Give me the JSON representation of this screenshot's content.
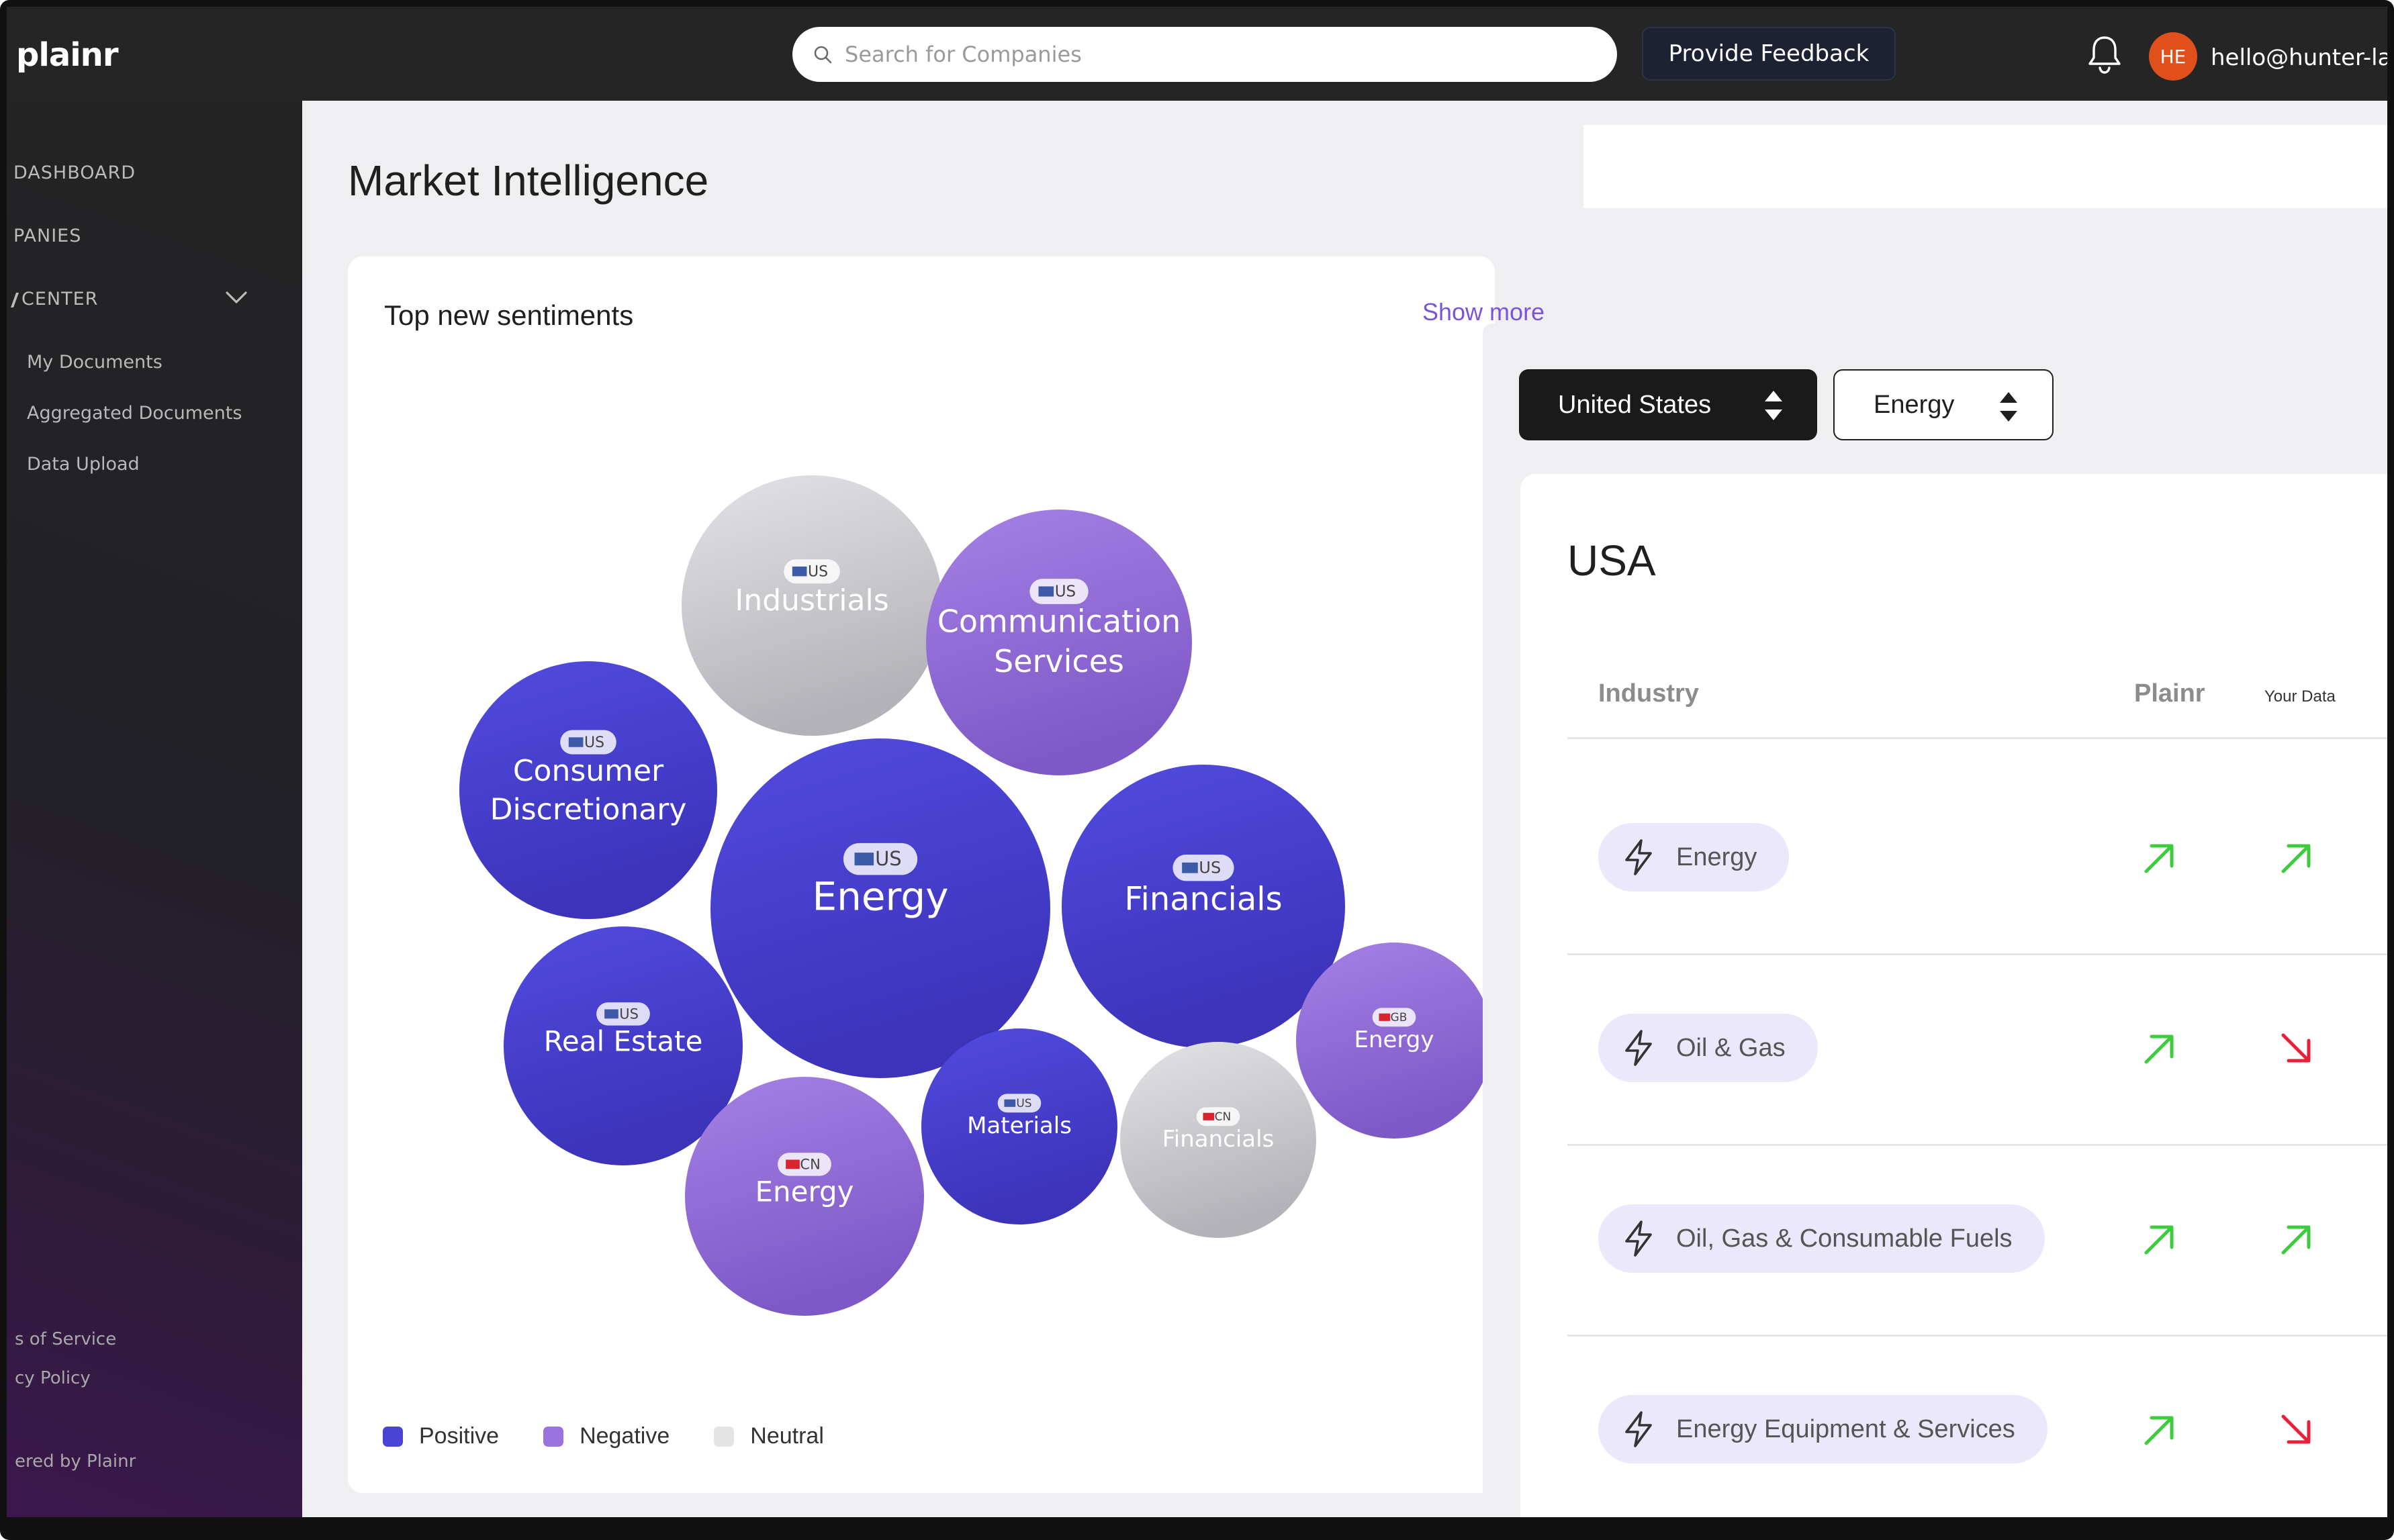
{
  "app": {
    "logo": "plainr"
  },
  "topbar": {
    "search_placeholder": "Search for Companies",
    "feedback_label": "Provide Feedback",
    "avatar_initials": "HE",
    "email": "hello@hunter-la"
  },
  "sidebar": {
    "items": [
      {
        "label": "DASHBOARD"
      },
      {
        "label": "PANIES"
      },
      {
        "label": "CENTER"
      }
    ],
    "sub_items": [
      {
        "label": "My Documents"
      },
      {
        "label": "Aggregated Documents"
      },
      {
        "label": "Data Upload"
      }
    ],
    "footer": {
      "terms": "s of Service",
      "privacy": "cy Policy",
      "powered": "ered by Plainr"
    }
  },
  "main": {
    "title": "Market Intelligence",
    "card_title": "Top new sentiments",
    "show_more": "Show more"
  },
  "colors": {
    "positive": "#4a44d6",
    "negative": "#9b73df",
    "neutral": "#e4e4e4",
    "accent": "#7b55d8",
    "up": "#3dcc3d",
    "down": "#e8213a"
  },
  "chart_data": {
    "type": "bubble",
    "bubbles": [
      {
        "name": "Industrials",
        "country": "US",
        "sentiment": "neutral"
      },
      {
        "name": "Communication Services",
        "country": "US",
        "sentiment": "negative"
      },
      {
        "name": "Consumer Discretionary",
        "country": "US",
        "sentiment": "positive"
      },
      {
        "name": "Energy",
        "country": "US",
        "sentiment": "positive"
      },
      {
        "name": "Financials",
        "country": "US",
        "sentiment": "positive"
      },
      {
        "name": "Real Estate",
        "country": "US",
        "sentiment": "positive"
      },
      {
        "name": "Energy",
        "country": "GB",
        "sentiment": "negative"
      },
      {
        "name": "Energy",
        "country": "CN",
        "sentiment": "negative"
      },
      {
        "name": "Materials",
        "country": "US",
        "sentiment": "positive"
      },
      {
        "name": "Financials",
        "country": "CN",
        "sentiment": "neutral"
      }
    ],
    "legend": [
      "Positive",
      "Negative",
      "Neutral"
    ]
  },
  "panel": {
    "country_select": "United States",
    "sector_select": "Energy",
    "country_title": "USA",
    "columns": {
      "industry": "Industry",
      "plainr": "Plainr",
      "your_data": "Your Data"
    },
    "rows": [
      {
        "industry": "Energy",
        "plainr": "up",
        "your_data": "up"
      },
      {
        "industry": "Oil & Gas",
        "plainr": "up",
        "your_data": "down"
      },
      {
        "industry": "Oil, Gas & Consumable Fuels",
        "plainr": "up",
        "your_data": "up"
      },
      {
        "industry": "Energy Equipment & Services",
        "plainr": "up",
        "your_data": "down"
      }
    ]
  }
}
